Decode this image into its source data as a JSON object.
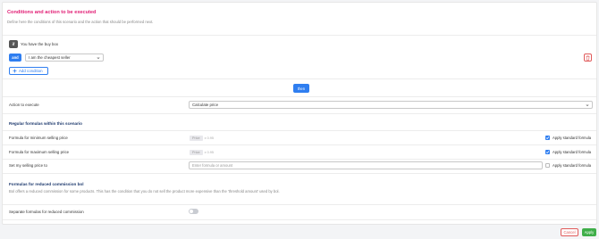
{
  "header": {
    "title": "Conditions and action to be executed",
    "description": "Define here the conditions of this scenario and the action that should be performed next."
  },
  "conditions": {
    "if_badge": "if",
    "if_text": "You have the buy box",
    "and_badge": "and",
    "and_select_value": "I am the cheapest seller",
    "add_condition_label": "Add condition"
  },
  "then_label": "then",
  "action": {
    "label": "Action to execute",
    "select_value": "Calculate price"
  },
  "regular_formulas": {
    "heading": "Regular formulas within this scenario",
    "rows": [
      {
        "label": "Formula for minimum selling price",
        "chip": "Price",
        "formula": "x 0.95",
        "checkbox_label": "Apply standard formula",
        "checked": true
      },
      {
        "label": "Formula for maximum selling price",
        "chip": "Price",
        "formula": "x 0.95",
        "checkbox_label": "Apply standard formula",
        "checked": true
      },
      {
        "label": "Set my selling price to",
        "placeholder": "Enter formula or amount",
        "checkbox_label": "Apply standard formula",
        "checked": false
      }
    ]
  },
  "reduced_commission": {
    "heading": "Formulas for reduced commission bol",
    "description": "Bol offers a reduced commission for some products. This has the condition that you do not sell the product more expensive than the 'threshold amount' used by bol.",
    "toggle_label": "Separate formulas for reduced commission",
    "toggle_on": false
  },
  "footer": {
    "cancel_label": "Cancel",
    "apply_label": "Apply"
  },
  "colors": {
    "accent": "#2f7ef0",
    "title": "#e11d74",
    "danger": "#e05a5a",
    "success": "#3fae49"
  }
}
